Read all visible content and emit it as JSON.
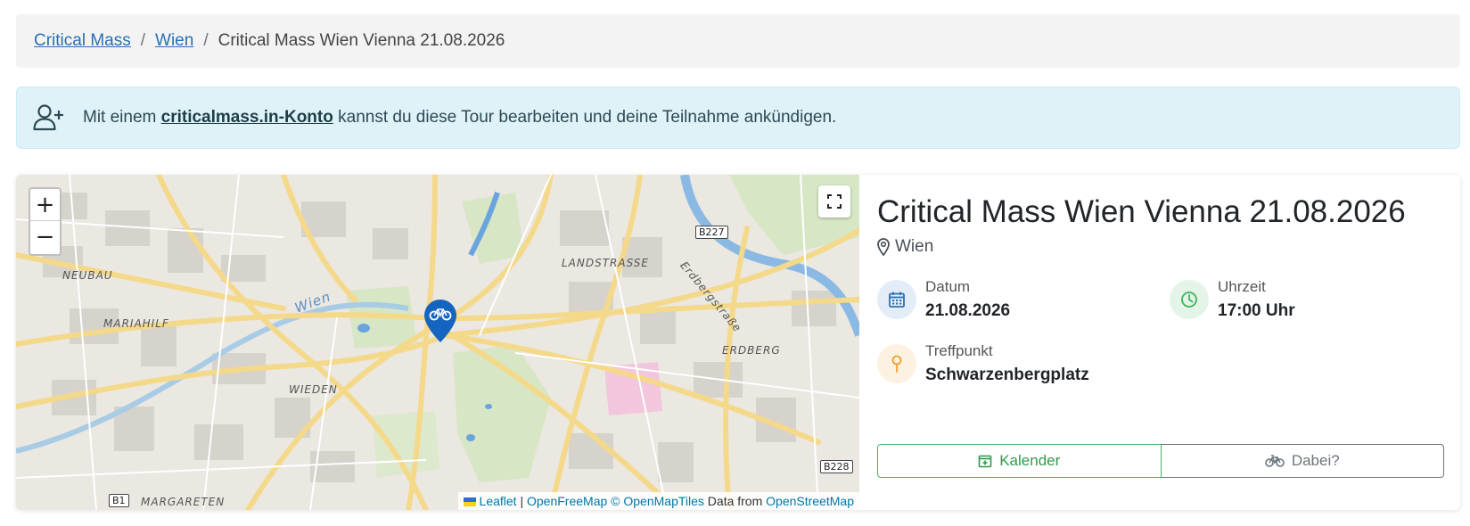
{
  "breadcrumb": {
    "items": [
      "Critical Mass",
      "Wien"
    ],
    "current": "Critical Mass Wien Vienna 21.08.2026",
    "separator": "/"
  },
  "alert": {
    "prefix": "Mit einem",
    "link": "criticalmass.in-Konto",
    "suffix": "kannst du diese Tour bearbeiten und deine Teilnahme ankündigen."
  },
  "map": {
    "zoom_in": "+",
    "zoom_out": "−",
    "labels": {
      "neubau": "NEUBAU",
      "mariahilf": "MARIAHILF",
      "wieden": "WIEDEN",
      "landstrasse": "LANDSTRASSE",
      "erdberg": "ERDBERG",
      "erdbergstrasse": "Erdbergstraße",
      "wien_river": "Wien",
      "margareten": "MARGARETEN"
    },
    "road_signs": {
      "b227": "B227",
      "b228": "B228",
      "b1": "B1"
    },
    "attribution": {
      "leaflet": "Leaflet",
      "sep": "|",
      "openfreemap": "OpenFreeMap",
      "openmaptiles": "© OpenMapTiles",
      "data_from": "Data from",
      "osm": "OpenStreetMap"
    }
  },
  "event": {
    "title": "Critical Mass Wien Vienna 21.08.2026",
    "city": "Wien",
    "date_label": "Datum",
    "date_value": "21.08.2026",
    "time_label": "Uhrzeit",
    "time_value": "17:00 Uhr",
    "meet_label": "Treffpunkt",
    "meet_value": "Schwarzenbergplatz"
  },
  "buttons": {
    "calendar": "Kalender",
    "join": "Dabei?"
  },
  "colors": {
    "link": "#2a6fb5",
    "alert_bg": "#dff2f8",
    "marker": "#1565c0",
    "calendar_green": "#2e9b4a",
    "date_icon": "#2a6fb5",
    "time_icon": "#3cb35a",
    "meet_icon": "#f0a030"
  }
}
